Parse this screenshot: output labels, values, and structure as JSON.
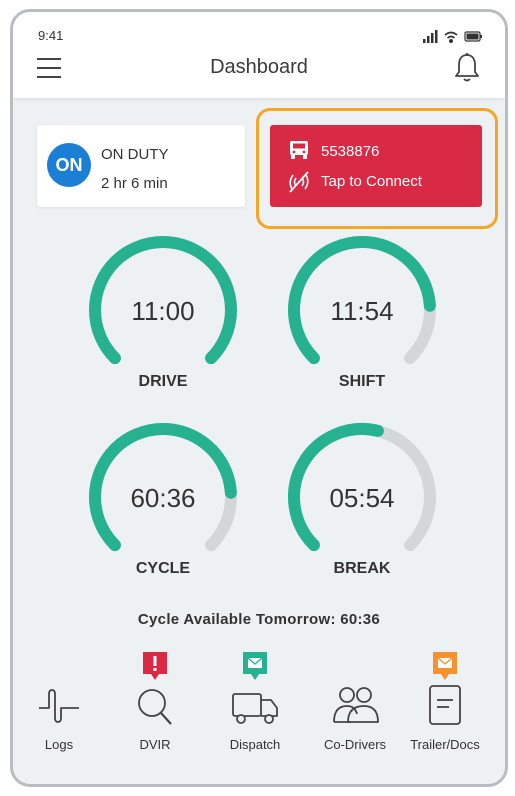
{
  "status_bar": {
    "time": "9:41"
  },
  "header": {
    "title": "Dashboard"
  },
  "duty": {
    "badge": "ON",
    "status": "ON DUTY",
    "duration": "2 hr 6 min"
  },
  "connection": {
    "truck_id": "5538876",
    "action": "Tap to Connect",
    "color": "#d92a45",
    "highlight_color": "#f5a623"
  },
  "gauges": [
    {
      "value": "11:00",
      "label": "DRIVE",
      "fraction": 1.0
    },
    {
      "value": "11:54",
      "label": "SHIFT",
      "fraction": 0.82
    },
    {
      "value": "60:36",
      "label": "CYCLE",
      "fraction": 0.82
    },
    {
      "value": "05:54",
      "label": "BREAK",
      "fraction": 0.55
    }
  ],
  "gauge_colors": {
    "fill": "#26b290",
    "track": "#d4d7da"
  },
  "cycle_available": "Cycle Available Tomorrow: 60:36",
  "nav": [
    {
      "label": "Logs",
      "icon": "logs-icon"
    },
    {
      "label": "DVIR",
      "icon": "search-icon",
      "badge": "alert-badge-icon",
      "badge_color": "#d92a45"
    },
    {
      "label": "Dispatch",
      "icon": "truck-icon",
      "badge": "message-badge-icon",
      "badge_color": "#26b290"
    },
    {
      "label": "Co-Drivers",
      "icon": "users-icon"
    },
    {
      "label": "Trailer/Docs",
      "icon": "document-icon",
      "badge": "message-badge-icon",
      "badge_color": "#f5922f"
    }
  ]
}
